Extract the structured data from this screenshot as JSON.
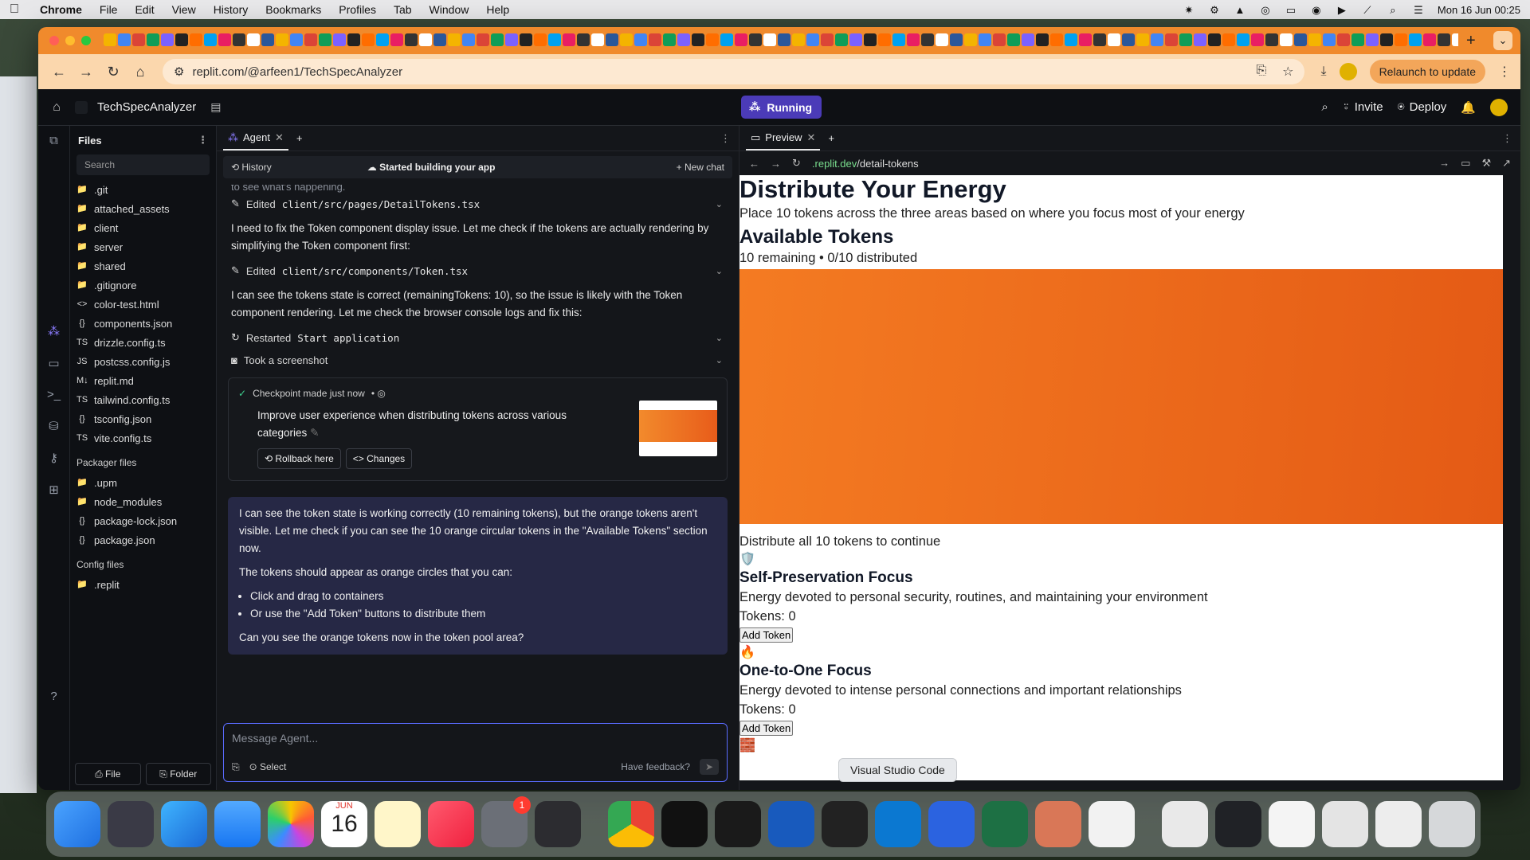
{
  "menubar": {
    "app": "Chrome",
    "items": [
      "File",
      "Edit",
      "View",
      "History",
      "Bookmarks",
      "Profiles",
      "Tab",
      "Window",
      "Help"
    ],
    "clock": "Mon 16 Jun  00:25"
  },
  "browser": {
    "url": "replit.com/@arfeen1/TechSpecAnalyzer",
    "relaunch_label": "Relaunch to update"
  },
  "replit": {
    "project_name": "TechSpecAnalyzer",
    "run_state": "Running",
    "invite_label": "Invite",
    "deploy_label": "Deploy"
  },
  "files": {
    "title": "Files",
    "search_placeholder": "Search",
    "items": [
      ".git",
      "attached_assets",
      "client",
      "server",
      "shared",
      ".gitignore",
      "color-test.html",
      "components.json",
      "drizzle.config.ts",
      "postcss.config.js",
      "replit.md",
      "tailwind.config.ts",
      "tsconfig.json",
      "vite.config.ts"
    ],
    "packager_title": "Packager files",
    "packager_items": [
      ".upm",
      "node_modules",
      "package-lock.json",
      "package.json"
    ],
    "config_title": "Config files",
    "config_items": [
      ".replit"
    ],
    "new_file_label": "File",
    "new_folder_label": "Folder"
  },
  "agent": {
    "tab_label": "Agent",
    "history_label": "History",
    "status_label": "Started building your app",
    "new_chat_label": "New chat",
    "cut_line": "to see what's happening.",
    "action1_prefix": "Edited",
    "action1_path": "client/src/pages/DetailTokens.tsx",
    "para1": "I need to fix the Token component display issue. Let me check if the tokens are actually rendering by simplifying the Token component first:",
    "action2_prefix": "Edited",
    "action2_path": "client/src/components/Token.tsx",
    "para2": "I can see the tokens state is correct (remainingTokens: 10), so the issue is likely with the Token component rendering. Let me check the browser console logs and fix this:",
    "action3_prefix": "Restarted",
    "action3_path": "Start application",
    "action4": "Took a screenshot",
    "checkpoint": {
      "header": "Checkpoint made just now",
      "text": "Improve user experience when distributing tokens across various categories",
      "rollback_label": "Rollback here",
      "changes_label": "Changes"
    },
    "bubble": {
      "p1": "I can see the token state is working correctly (10 remaining tokens), but the orange tokens aren't visible. Let me check if you can see the 10 orange circular tokens in the \"Available Tokens\" section now.",
      "p2": "The tokens should appear as orange circles that you can:",
      "bullet1": "Click and drag to containers",
      "bullet2": "Or use the \"Add Token\" buttons to distribute them",
      "p3": "Can you see the orange tokens now in the token pool area?"
    },
    "composer_placeholder": "Message Agent...",
    "select_label": "Select",
    "feedback_label": "Have feedback?"
  },
  "preview": {
    "tab_label": "Preview",
    "url_host": ".replit.dev",
    "url_path": "/detail-tokens",
    "title": "Distribute Your Energy",
    "subtitle": "Place 10 tokens across the three areas based on where you focus most of your energy",
    "available_heading": "Available Tokens",
    "remaining_text": "10 remaining • 0/10 distributed",
    "continue_text": "Distribute all 10 tokens to continue",
    "areas": [
      {
        "emoji": "🛡️",
        "title": "Self-Preservation Focus",
        "desc": "Energy devoted to personal security, routines, and maintaining your environment",
        "tokens": "Tokens: 0",
        "button": "Add Token"
      },
      {
        "emoji": "🔥",
        "title": "One-to-One Focus",
        "desc": "Energy devoted to intense personal connections and important relationships",
        "tokens": "Tokens: 0",
        "button": "Add Token"
      }
    ],
    "third_emoji": "🧱"
  },
  "tooltip": "Visual Studio Code",
  "dock": {
    "calendar_month": "JUN",
    "calendar_day": "16",
    "settings_badge": "1"
  },
  "colors": {
    "tab_orange": "#f08a2c",
    "running_purple": "#4b3bb8",
    "token_area_orange": "#e45a15",
    "agent_bubble": "#262845"
  }
}
